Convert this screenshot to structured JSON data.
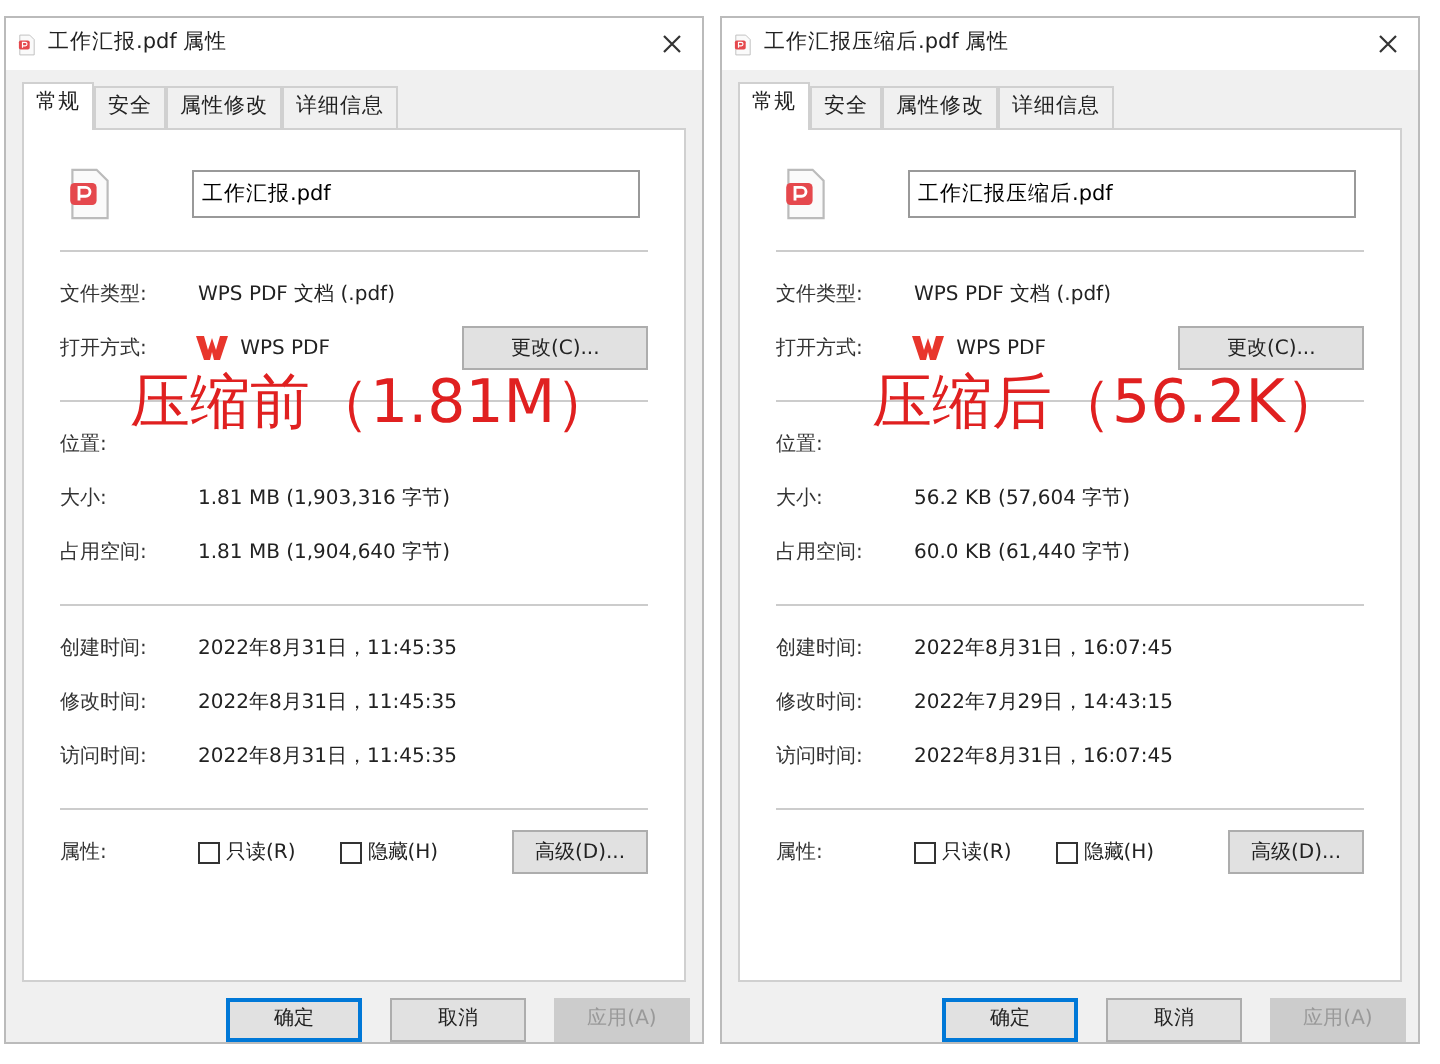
{
  "dialogs": [
    {
      "title": "工作汇报.pdf 属性",
      "tabs": [
        {
          "label": "常规",
          "selected": true
        },
        {
          "label": "安全",
          "selected": false
        },
        {
          "label": "属性修改",
          "selected": false
        },
        {
          "label": "详细信息",
          "selected": false
        }
      ],
      "file_name": "工作汇报.pdf",
      "groups": [
        [
          {
            "label": "文件类型:",
            "value": "WPS PDF 文档 (.pdf)"
          },
          {
            "label": "打开方式:",
            "value": "WPS PDF",
            "kind": "app",
            "button": "更改(C)..."
          }
        ],
        [
          {
            "label": "位置:"
          },
          {
            "label": "大小:",
            "value": "1.81 MB (1,903,316 字节)"
          },
          {
            "label": "占用空间:",
            "value": "1.81 MB (1,904,640 字节)"
          }
        ],
        [
          {
            "label": "创建时间:",
            "value": "2022年8月31日，11:45:35"
          },
          {
            "label": "修改时间:",
            "value": "2022年8月31日，11:45:35"
          },
          {
            "label": "访问时间:",
            "value": "2022年8月31日，11:45:35"
          }
        ]
      ],
      "attributes": {
        "label": "属性:",
        "checkboxes": [
          {
            "label": "只读(R)",
            "checked": false
          },
          {
            "label": "隐藏(H)",
            "checked": false
          }
        ],
        "button": "高级(D)..."
      },
      "annotation": "压缩前（1.81M）",
      "buttons": [
        {
          "label": "确定",
          "kind": "default"
        },
        {
          "label": "取消",
          "kind": "normal"
        },
        {
          "label": "应用(A)",
          "kind": "disabled"
        }
      ]
    },
    {
      "title": "工作汇报压缩后.pdf 属性",
      "tabs": [
        {
          "label": "常规",
          "selected": true
        },
        {
          "label": "安全",
          "selected": false
        },
        {
          "label": "属性修改",
          "selected": false
        },
        {
          "label": "详细信息",
          "selected": false
        }
      ],
      "file_name": "工作汇报压缩后.pdf",
      "groups": [
        [
          {
            "label": "文件类型:",
            "value": "WPS PDF 文档 (.pdf)"
          },
          {
            "label": "打开方式:",
            "value": "WPS PDF",
            "kind": "app",
            "button": "更改(C)..."
          }
        ],
        [
          {
            "label": "位置:"
          },
          {
            "label": "大小:",
            "value": "56.2 KB (57,604 字节)"
          },
          {
            "label": "占用空间:",
            "value": "60.0 KB (61,440 字节)"
          }
        ],
        [
          {
            "label": "创建时间:",
            "value": "2022年8月31日，16:07:45"
          },
          {
            "label": "修改时间:",
            "value": "2022年7月29日，14:43:15"
          },
          {
            "label": "访问时间:",
            "value": "2022年8月31日，16:07:45"
          }
        ]
      ],
      "attributes": {
        "label": "属性:",
        "checkboxes": [
          {
            "label": "只读(R)",
            "checked": false
          },
          {
            "label": "隐藏(H)",
            "checked": false
          }
        ],
        "button": "高级(D)..."
      },
      "annotation": "压缩后（56.2K）",
      "buttons": [
        {
          "label": "确定",
          "kind": "default"
        },
        {
          "label": "取消",
          "kind": "normal"
        },
        {
          "label": "应用(A)",
          "kind": "disabled"
        }
      ]
    }
  ]
}
